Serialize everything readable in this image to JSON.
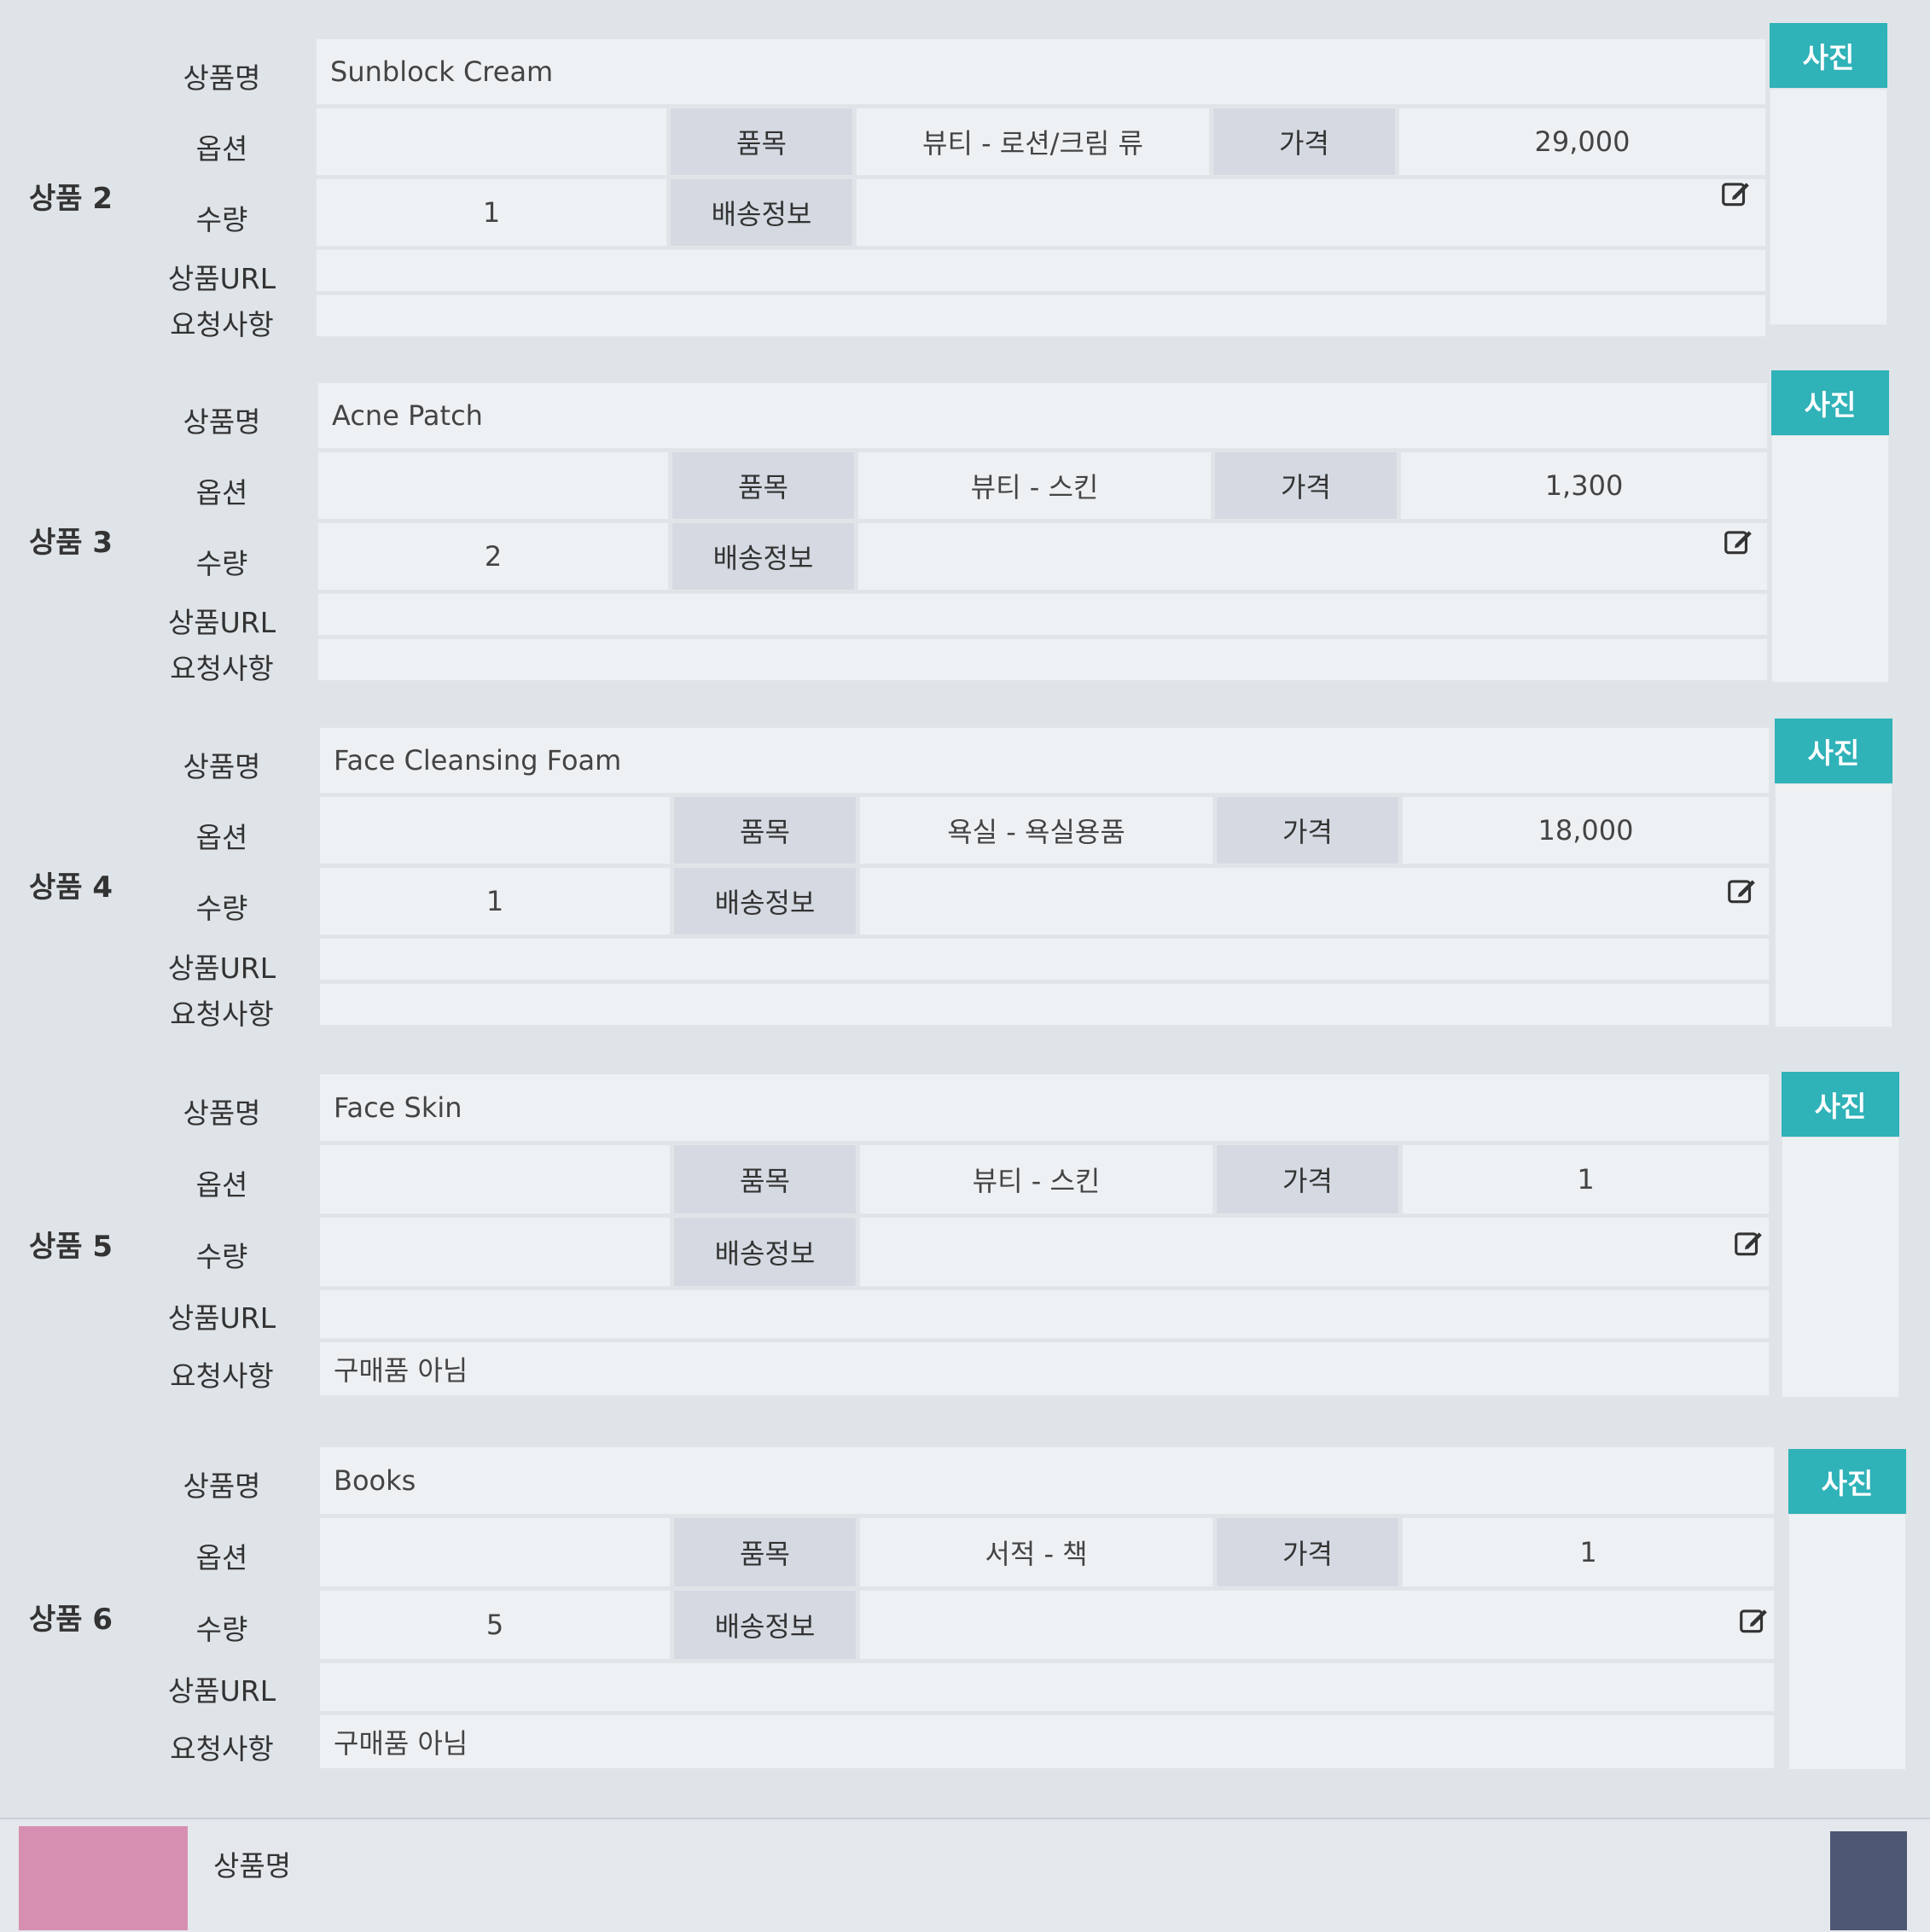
{
  "labels": {
    "name": "상품명",
    "option": "옵션",
    "qty": "수량",
    "url": "상품URL",
    "request": "요청사항",
    "category": "품목",
    "shipping": "배송정보",
    "price": "가격",
    "photo": "사진"
  },
  "products": [
    {
      "title": "상품 2",
      "name": "Sunblock Cream",
      "option": "",
      "qty": "1",
      "category": "뷰티 - 로션/크림 류",
      "price": "29,000",
      "shipping": "",
      "url": "",
      "request": ""
    },
    {
      "title": "상품 3",
      "name": "Acne Patch",
      "option": "",
      "qty": "2",
      "category": "뷰티 - 스킨",
      "price": "1,300",
      "shipping": "",
      "url": "",
      "request": ""
    },
    {
      "title": "상품 4",
      "name": "Face Cleansing Foam",
      "option": "",
      "qty": "1",
      "category": "욕실 - 욕실용품",
      "price": "18,000",
      "shipping": "",
      "url": "",
      "request": ""
    },
    {
      "title": "상품 5",
      "name": "Face Skin",
      "option": "",
      "qty": "",
      "category": "뷰티 - 스킨",
      "price": "1",
      "shipping": "",
      "url": "",
      "request": "구매품 아님"
    },
    {
      "title": "상품 6",
      "name": "Books",
      "option": "",
      "qty": "5",
      "category": "서적 - 책",
      "price": "1",
      "shipping": "",
      "url": "",
      "request": "구매품 아님"
    }
  ],
  "footer": {
    "name_label": "상품명"
  }
}
